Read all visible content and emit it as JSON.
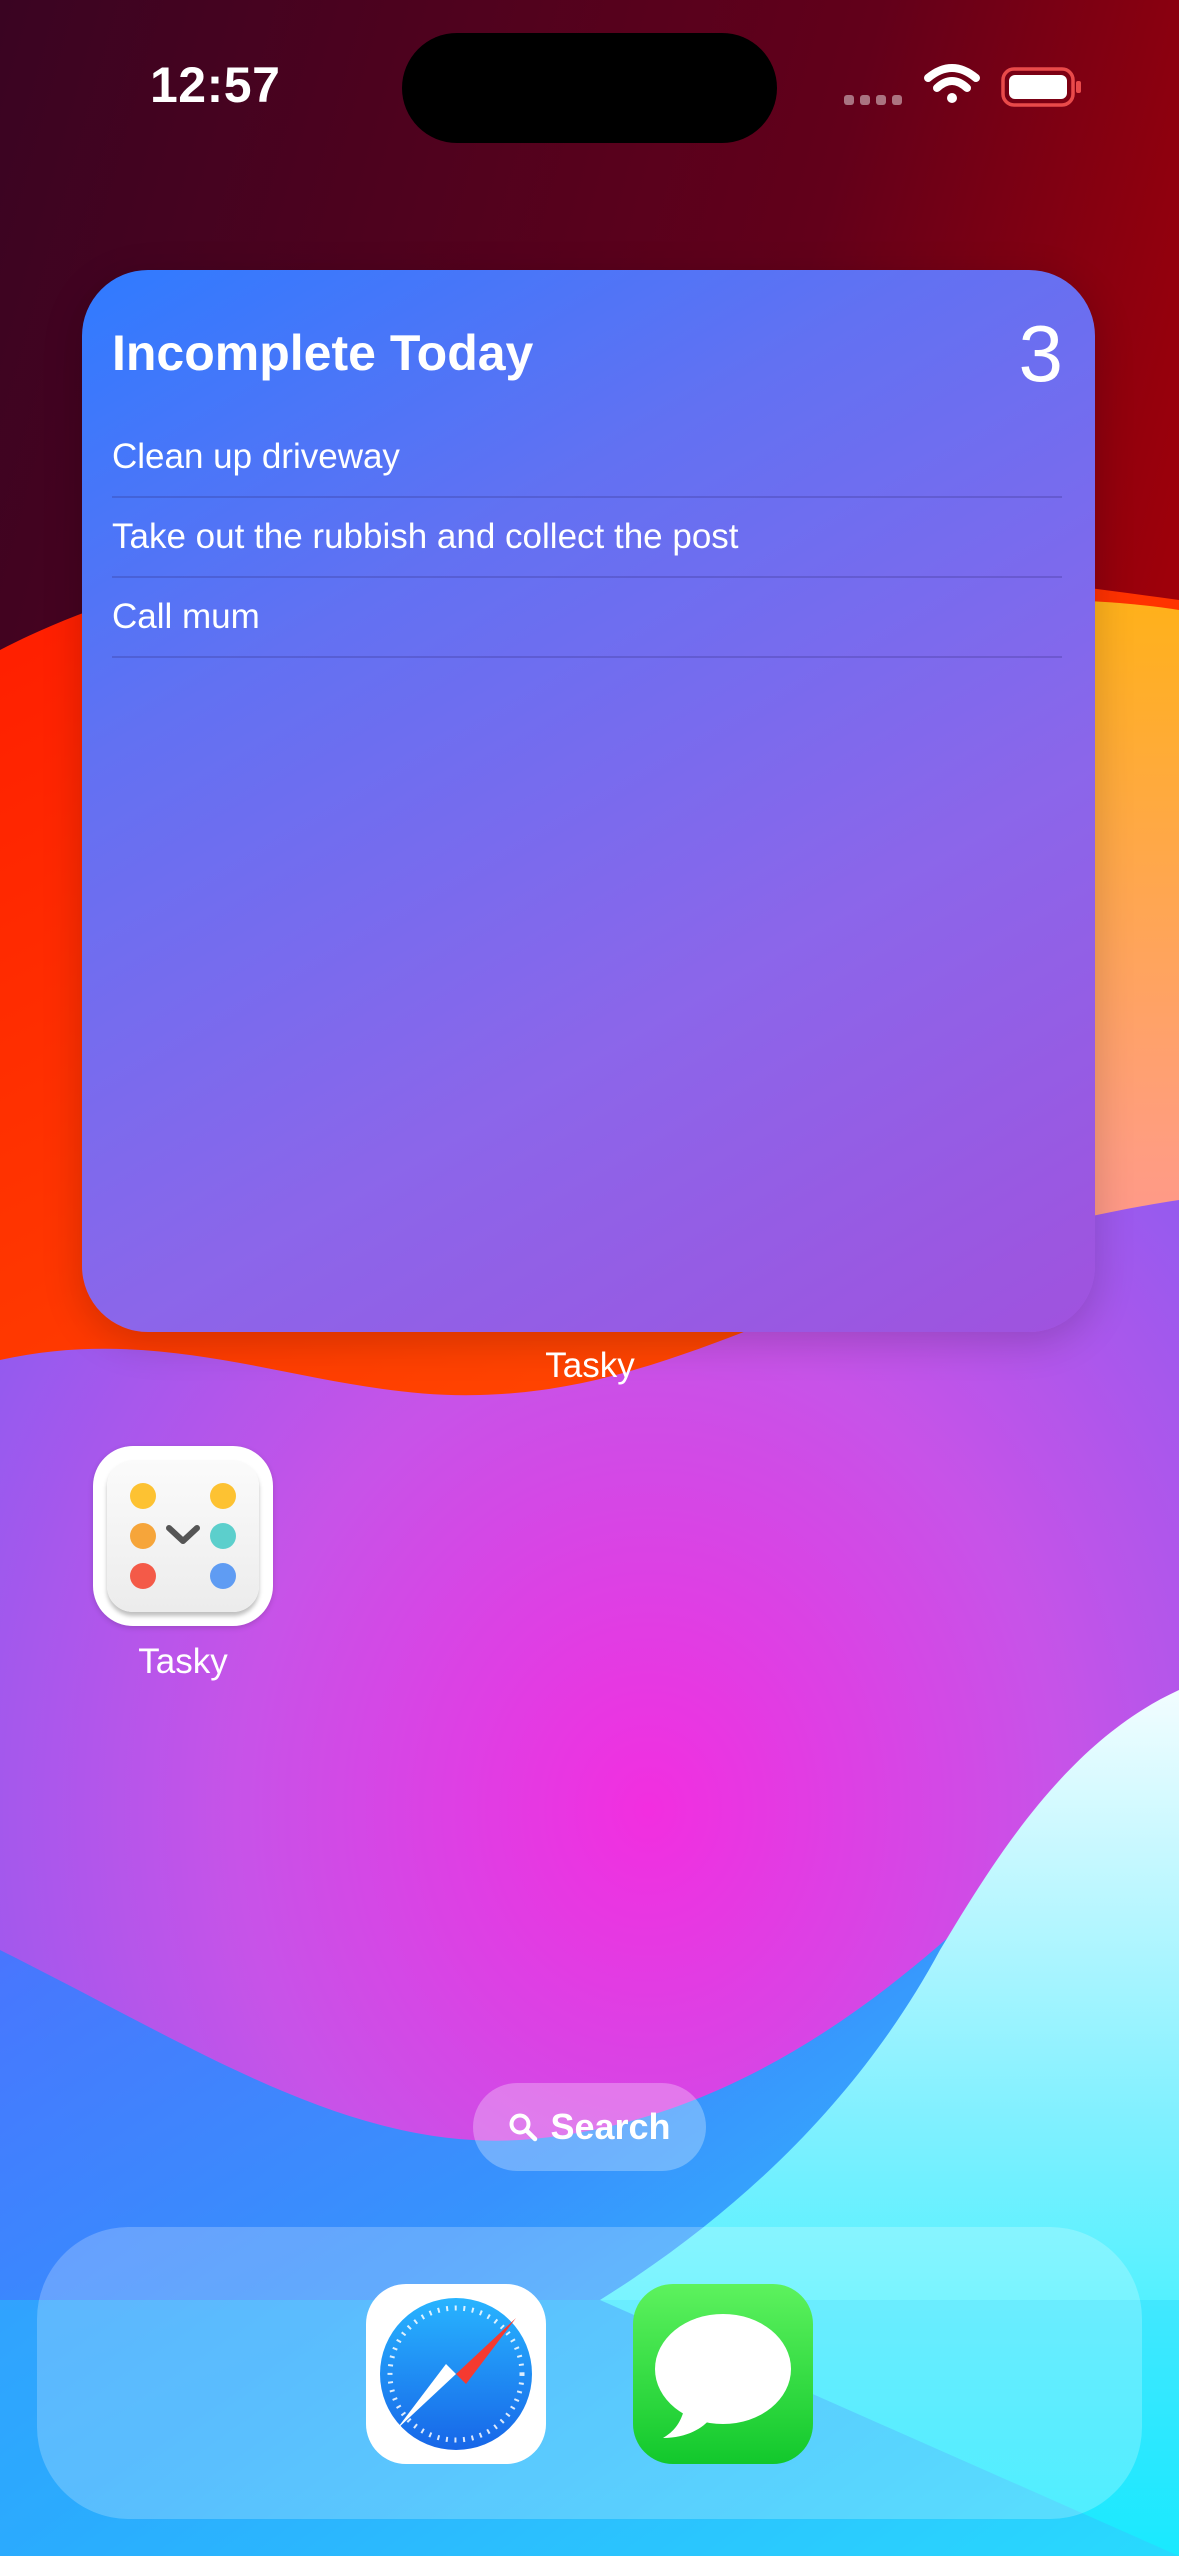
{
  "status_bar": {
    "time": "12:57",
    "icons": [
      "cellular-icon",
      "wifi-icon",
      "battery-icon"
    ]
  },
  "widget": {
    "title": "Incomplete Today",
    "count": "3",
    "tasks": [
      "Clean up driveway",
      "Take out the rubbish and collect the post",
      "Call mum"
    ],
    "label": "Tasky"
  },
  "app": {
    "name": "Tasky",
    "icon": "tasky-app-icon"
  },
  "search": {
    "label": "Search",
    "icon": "search-icon"
  },
  "dock": {
    "apps": [
      "safari-icon",
      "messages-icon"
    ]
  },
  "colors": {
    "widget_start": "#2f7bff",
    "widget_end": "#a052de",
    "messages_green": "#12c82c",
    "safari_blue": "#1f7cf3"
  }
}
